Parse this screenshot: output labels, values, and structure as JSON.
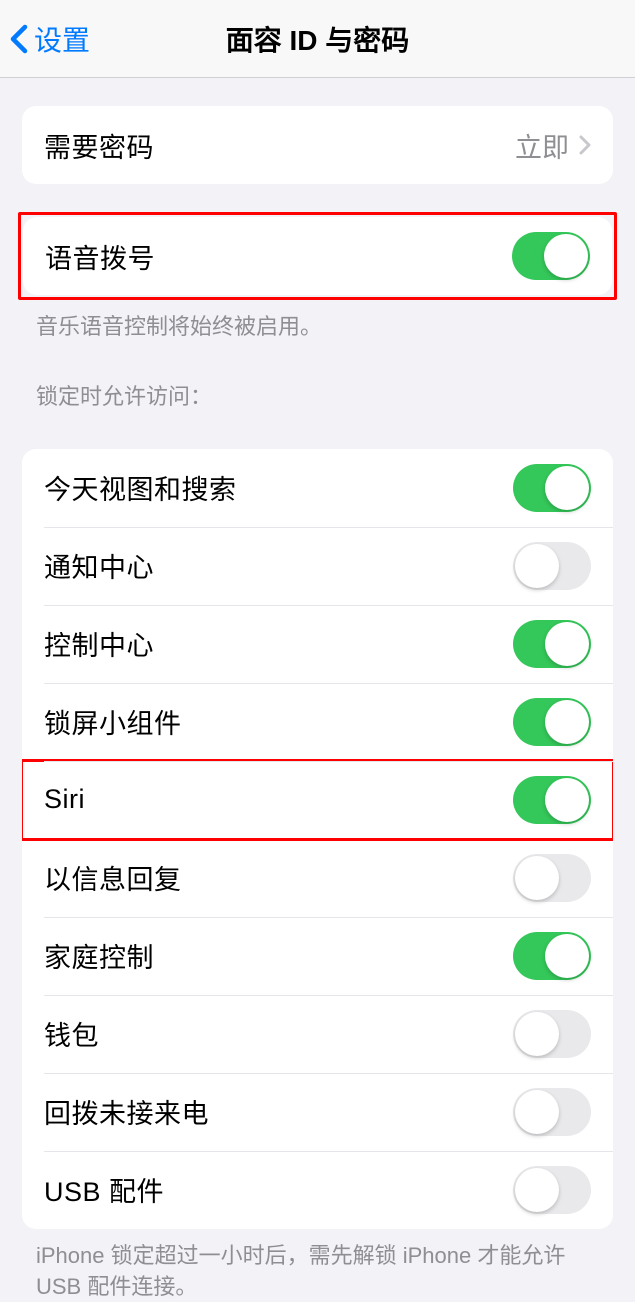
{
  "header": {
    "back_label": "设置",
    "title": "面容 ID 与密码"
  },
  "require_passcode": {
    "label": "需要密码",
    "value": "立即"
  },
  "voice_dial": {
    "label": "语音拨号",
    "footer": "音乐语音控制将始终被启用。",
    "on": true
  },
  "locked_access": {
    "header": "锁定时允许访问：",
    "items": [
      {
        "label": "今天视图和搜索",
        "on": true,
        "name": "today-view"
      },
      {
        "label": "通知中心",
        "on": false,
        "name": "notification-center"
      },
      {
        "label": "控制中心",
        "on": true,
        "name": "control-center"
      },
      {
        "label": "锁屏小组件",
        "on": true,
        "name": "lock-screen-widgets"
      },
      {
        "label": "Siri",
        "on": true,
        "name": "siri",
        "highlight": true
      },
      {
        "label": "以信息回复",
        "on": false,
        "name": "reply-with-message"
      },
      {
        "label": "家庭控制",
        "on": true,
        "name": "home-control"
      },
      {
        "label": "钱包",
        "on": false,
        "name": "wallet"
      },
      {
        "label": "回拨未接来电",
        "on": false,
        "name": "return-missed-calls"
      },
      {
        "label": "USB 配件",
        "on": false,
        "name": "usb-accessories"
      }
    ],
    "footer": "iPhone 锁定超过一小时后，需先解锁 iPhone 才能允许 USB 配件连接。"
  }
}
